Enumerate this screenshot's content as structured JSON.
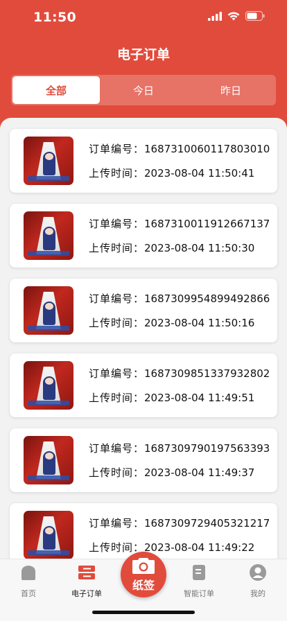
{
  "status_bar": {
    "time": "11:50"
  },
  "nav": {
    "title": "电子订单"
  },
  "tabs": [
    {
      "label": "全部",
      "active": true
    },
    {
      "label": "今日",
      "active": false
    },
    {
      "label": "昨日",
      "active": false
    }
  ],
  "order_label": "订单编号：",
  "time_label": "上传时间：",
  "orders": [
    {
      "order_no": "1687310060117803010",
      "upload_time": "2023-08-04 11:50:41"
    },
    {
      "order_no": "1687310011912667137",
      "upload_time": "2023-08-04 11:50:30"
    },
    {
      "order_no": "1687309954899492866",
      "upload_time": "2023-08-04 11:50:16"
    },
    {
      "order_no": "1687309851337932802",
      "upload_time": "2023-08-04 11:49:51"
    },
    {
      "order_no": "1687309790197563393",
      "upload_time": "2023-08-04 11:49:37"
    },
    {
      "order_no": "1687309729405321217",
      "upload_time": "2023-08-04 11:49:22"
    }
  ],
  "tabbar": {
    "home": "首页",
    "orders": "电子订单",
    "camera": "纸签",
    "smart_orders": "智能订单",
    "mine": "我的"
  },
  "colors": {
    "accent": "#e14b3c"
  }
}
